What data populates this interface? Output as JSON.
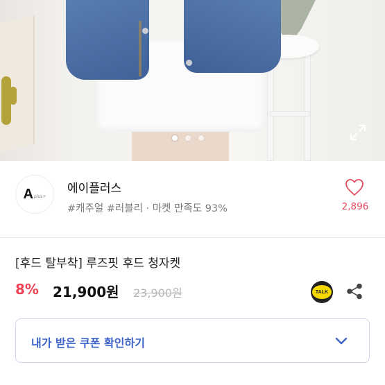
{
  "product_image": {
    "carousel_dots": [
      true,
      false,
      false
    ]
  },
  "seller": {
    "logo_text": "A",
    "logo_sub": "plus+",
    "name": "에이플러스",
    "tags": "#캐주얼 #러블리 · 마켓 만족도 93%",
    "likes": "2,896"
  },
  "product": {
    "title": "[후드 탈부착] 루즈핏 후드 청자켓",
    "discount": "8%",
    "price": "21,900원",
    "original_price": "23,900원",
    "talk_label": "TALK"
  },
  "coupon": {
    "label": "내가 받은 쿠폰 확인하기"
  },
  "colors": {
    "discount": "#f04356",
    "likes": "#e24a5e",
    "coupon_text": "#3d63c9",
    "talk_yellow": "#f6d700"
  }
}
